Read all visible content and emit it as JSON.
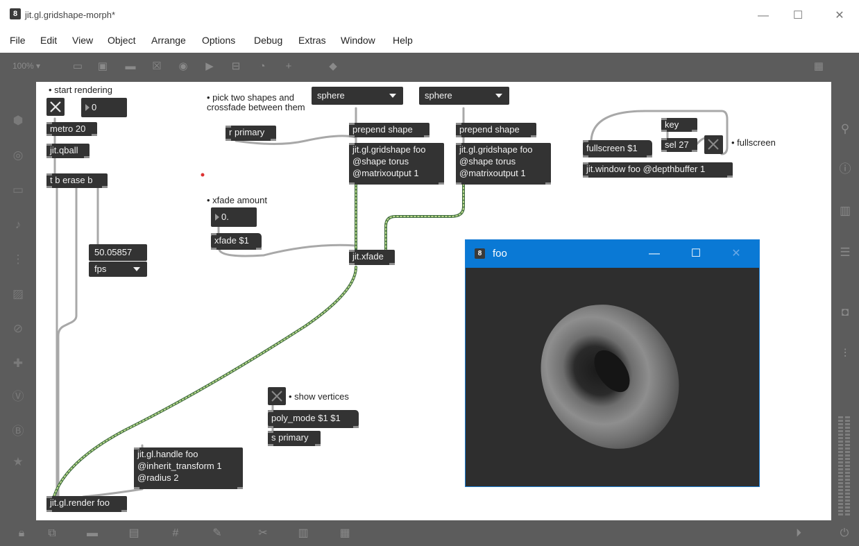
{
  "window": {
    "title": "jit.gl.gridshape-morph*",
    "logo": "8",
    "minimize": "—",
    "maximize": "☐",
    "close": "✕"
  },
  "menu": [
    "File",
    "Edit",
    "View",
    "Object",
    "Arrange",
    "Options",
    "Debug",
    "Extras",
    "Window",
    "Help"
  ],
  "toolbar": {
    "zoom": "100% ▾",
    "icons": [
      "presentation-icon",
      "bpatcher-icon",
      "comment-icon",
      "toggle-icon",
      "button-icon",
      "number-icon",
      "slider-icon",
      "dial-icon",
      "plus-icon",
      "paint-icon",
      "grid-icon"
    ]
  },
  "left_sidebar_icons": [
    "object-box-icon",
    "target-icon",
    "keyboard-icon",
    "music-note-icon",
    "data-flow-icon",
    "image-icon",
    "link-icon",
    "plug-icon",
    "v-icon",
    "b-icon",
    "star-icon"
  ],
  "right_sidebar_icons": [
    "search-icon",
    "info-icon",
    "book-icon",
    "list-icon",
    "camera-icon",
    "mixer-icon"
  ],
  "bottom_icons": [
    "lock-icon",
    "presentation-mode-icon",
    "comment-mode-icon",
    "layers-icon",
    "grid-icon",
    "patch-cord-icon",
    "wrench-icon",
    "piano-icon",
    "keyboard-icon"
  ],
  "bottom_right_icons": [
    "play-icon",
    "power-icon"
  ],
  "patch": {
    "comment_start_rendering": "• start rendering",
    "comment_pick": "• pick two shapes and\ncrossfade between them",
    "comment_xfade_amount": "• xfade amount",
    "comment_show_vertices": "• show vertices",
    "comment_fullscreen": "• fullscreen",
    "number_top": "0",
    "number_xfade": "0.",
    "fps_value": "50.05857",
    "fps_menu": "fps",
    "metro": "metro 20",
    "qball": "jit.qball",
    "trigger": "t b erase b",
    "r_primary": "r primary",
    "shape_menu_1": "sphere",
    "shape_menu_2": "sphere",
    "prepend_1": "prepend shape",
    "prepend_2": "prepend shape",
    "gridshape_1": "jit.gl.gridshape foo\n@shape torus\n@matrixoutput 1",
    "gridshape_2": "jit.gl.gridshape foo\n@shape torus\n@matrixoutput 1",
    "xfade_msg": "xfade $1",
    "xfade": "jit.xfade",
    "key": "key",
    "sel": "sel 27",
    "fullscreen_msg": "fullscreen $1",
    "window_obj": "jit.window foo @depthbuffer 1",
    "poly_mode": "poly_mode $1 $1",
    "s_primary": "s primary",
    "handle": "jit.gl.handle foo\n@inherit_transform 1\n@radius 2",
    "render": "jit.gl.render foo"
  },
  "foo_window": {
    "title": "foo",
    "logo": "8",
    "minimize": "—",
    "maximize": "☐",
    "close": "✕"
  }
}
